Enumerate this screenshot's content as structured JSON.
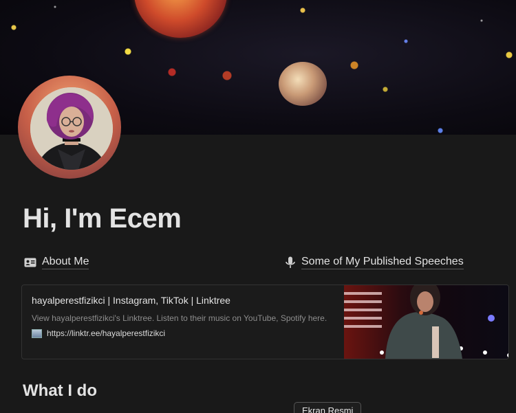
{
  "page": {
    "title": "Hi, I'm Ecem"
  },
  "links": {
    "about": {
      "label": "About Me",
      "icon": "contact-card-icon"
    },
    "speeches": {
      "label": "Some of My Published Speeches",
      "icon": "microphone-icon"
    }
  },
  "bookmark": {
    "title": "hayalperestfizikci | Instagram, TikTok | Linktree",
    "description": "View hayalperestfizikci's Linktree. Listen to their music on YouTube, Spotify here.",
    "url": "https://linktr.ee/hayalperestfizikci",
    "favicon": "image-favicon-icon"
  },
  "sections": {
    "what_i_do": "What I do"
  },
  "tooltip": {
    "text": "Ekran Resmi"
  },
  "colors": {
    "background": "#191919",
    "text": "#e3e3e3",
    "muted": "#8d8d8d"
  }
}
